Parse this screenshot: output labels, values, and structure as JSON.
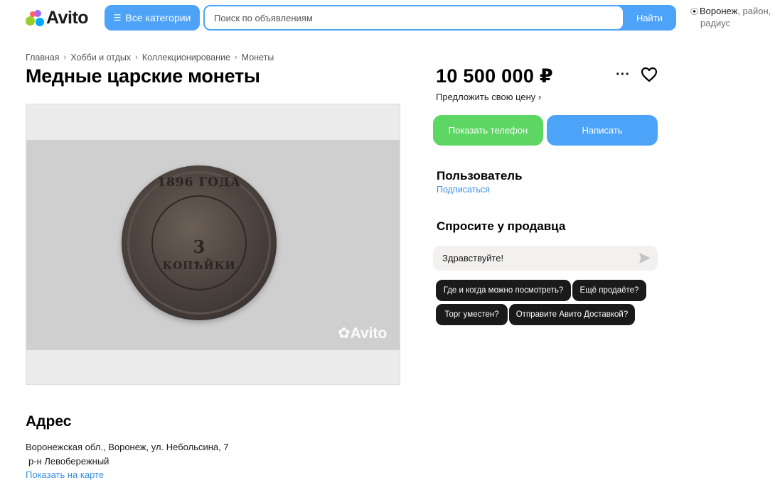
{
  "header": {
    "logo_text": "Avito",
    "categories_label": "Все категории",
    "search_placeholder": "Поиск по объявлениям",
    "search_button": "Найти",
    "location_city": "Воронеж",
    "location_rest_1": ", район,",
    "location_rest_2": "радиус"
  },
  "breadcrumb": [
    "Главная",
    "Хобби и отдых",
    "Коллекционирование",
    "Монеты"
  ],
  "listing": {
    "title": "Медные царские монеты",
    "photo_watermark": "Avito",
    "coin_year": "1896 ГОДА",
    "coin_number": "3",
    "coin_denomination": "КОПѢЙКИ"
  },
  "address": {
    "title": "Адрес",
    "line1": "Воронежская обл., Воронеж, ул. Небольсина, 7",
    "line2": "р-н Левобережный",
    "map_link": "Показать на карте"
  },
  "sidebar": {
    "price": "10 500 000 ₽",
    "offer_price": "Предложить свою цену",
    "show_phone": "Показать телефон",
    "write": "Написать",
    "seller_name": "Пользователь",
    "subscribe": "Подписаться",
    "ask_title": "Спросите у продавца",
    "ask_value": "Здравствуйте!",
    "quick_questions": [
      "Где и когда можно посмотреть?",
      "Ещё продаёте?",
      "Торг уместен?",
      "Отправите Авито Доставкой?"
    ]
  },
  "colors": {
    "accent_blue": "#4da3f7",
    "phone_green": "#5ed664",
    "link_blue": "#3a90e2"
  }
}
